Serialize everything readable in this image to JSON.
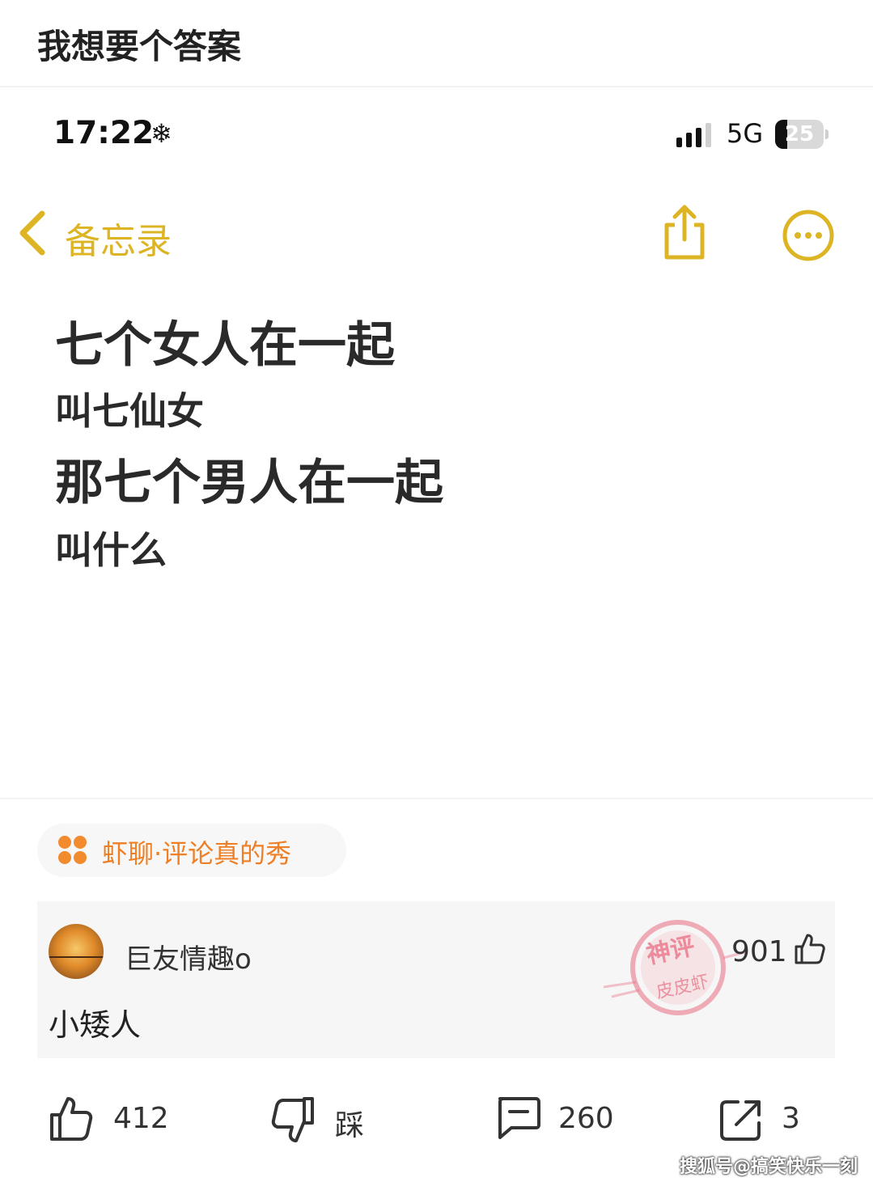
{
  "post": {
    "title": "我想要个答案"
  },
  "status_bar": {
    "time": "17:22",
    "weather_icon": "snowflake-icon",
    "network": "5G",
    "battery_level": "25",
    "battery_fraction": 0.25
  },
  "notes_app": {
    "back_label": "备忘录",
    "accent_color": "#dcb424",
    "lines": [
      "七个女人在一起",
      "叫七仙女",
      "那七个男人在一起",
      "叫什么"
    ]
  },
  "topic": {
    "label": "虾聊·评论真的秀",
    "color": "#ef7f24"
  },
  "comment": {
    "username": "巨友情趣o",
    "text": "小矮人",
    "likes": "901",
    "stamp_line1": "神评",
    "stamp_line2": "皮皮虾"
  },
  "actions": {
    "upvotes": "412",
    "downvote_label": "踩",
    "comments": "260",
    "shares": "3"
  },
  "watermark": "搜狐号@搞笑快乐一刻"
}
